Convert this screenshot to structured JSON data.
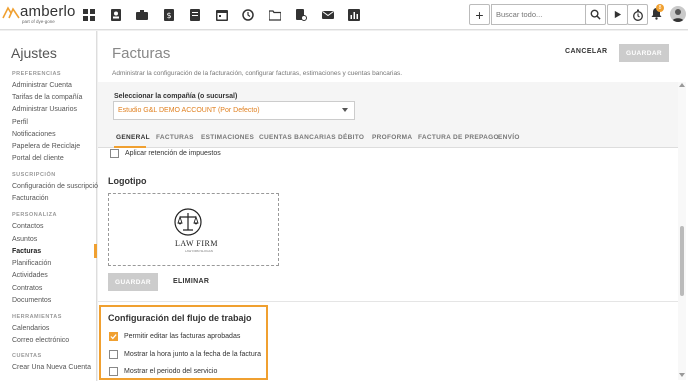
{
  "brand": {
    "name": "amberlo",
    "tagline": "part of dye-gone",
    "accent": "#f0a030"
  },
  "topbar": {
    "nav_icons": [
      "dashboard-icon",
      "contacts-icon",
      "briefcase-icon",
      "billing-icon",
      "document-icon",
      "calendar-icon",
      "timer-history-icon",
      "folder-icon",
      "document-settings-icon",
      "mail-icon",
      "reports-icon"
    ],
    "add_label": "+",
    "search_placeholder": "Buscar todo...",
    "notification_count": "8"
  },
  "sidebar": {
    "title": "Ajustes",
    "sections": [
      {
        "label": "PREFERENCIAS",
        "items": [
          "Administrar Cuenta",
          "Tarifas de la compañía",
          "Administrar Usuarios",
          "Perfil",
          "Notificaciones",
          "Papelera de Reciclaje",
          "Portal del cliente"
        ]
      },
      {
        "label": "SUSCRIPCIÓN",
        "items": [
          "Configuración de suscripción",
          "Facturación"
        ]
      },
      {
        "label": "PERSONALIZA",
        "items": [
          "Contactos",
          "Asuntos",
          "Facturas",
          "Planificación",
          "Actividades",
          "Contratos",
          "Documentos"
        ]
      },
      {
        "label": "HERRAMIENTAS",
        "items": [
          "Calendarios",
          "Correo electrónico"
        ]
      },
      {
        "label": "CUENTAS",
        "items": [
          "Crear Una Nueva Cuenta"
        ]
      }
    ],
    "active_item": "Facturas"
  },
  "main": {
    "title": "Facturas",
    "description": "Administrar la configuración de la facturación, configurar facturas, estimaciones y cuentas bancarias.",
    "cancel_label": "CANCELAR",
    "save_label": "GUARDAR",
    "company_label": "Seleccionar la compañía (o sucursal)",
    "company_value": "Estudio G&L DEMO ACCOUNT (Por Defecto)",
    "tabs": [
      "GENERAL",
      "FACTURAS",
      "ESTIMACIONES",
      "CUENTAS BANCARIAS",
      "DÉBITO",
      "PROFORMA",
      "FACTURA DE PREPAGO",
      "ENVÍO"
    ],
    "active_tab": "GENERAL",
    "tax_checkbox": {
      "label": "Aplicar retención de impuestos",
      "checked": false
    },
    "logo_section": {
      "title": "Logotipo",
      "logo_text": "LAW FIRM",
      "logo_subtext": "LAW FIRM SLOGAN",
      "save_label": "GUARDAR",
      "delete_label": "ELIMINAR"
    },
    "workflow": {
      "title": "Configuración del flujo de trabajo",
      "options": [
        {
          "label": "Permitir editar las facturas aprobadas",
          "checked": true
        },
        {
          "label": "Mostrar la hora junto a la fecha de la factura",
          "checked": false
        },
        {
          "label": "Mostrar el periodo del servicio",
          "checked": false
        }
      ]
    }
  }
}
